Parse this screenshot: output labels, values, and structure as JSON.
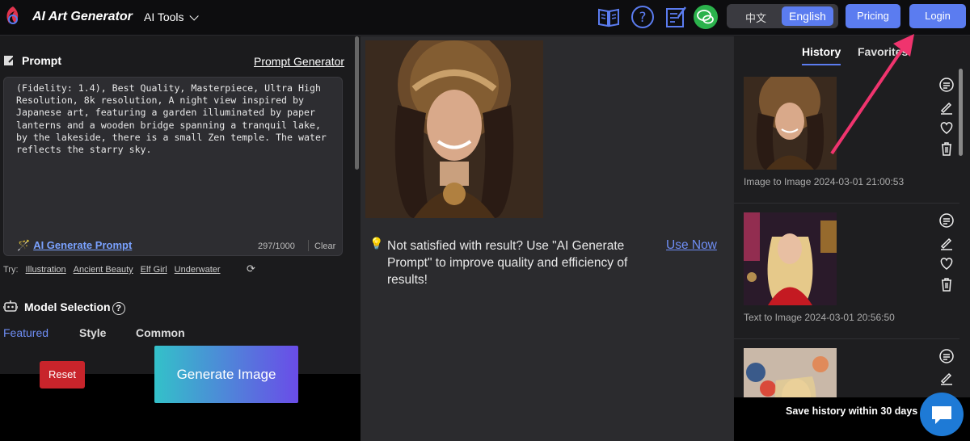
{
  "header": {
    "brand": "AI Art Generator",
    "ai_tools": "AI Tools",
    "lang_zh": "中文",
    "lang_en": "English",
    "pricing": "Pricing",
    "login": "Login"
  },
  "prompt": {
    "heading": "Prompt",
    "generator_link": "Prompt Generator",
    "text": "(Fidelity: 1.4), Best Quality, Masterpiece, Ultra High Resolution, 8k resolution, A night view inspired by Japanese art, featuring a garden illuminated by paper lanterns and a wooden bridge spanning a tranquil lake, by the lakeside, there is a small Zen temple. The water reflects the starry sky.",
    "ai_generate": "AI Generate Prompt",
    "count": "297/1000",
    "clear": "Clear",
    "try_label": "Try:",
    "try_items": [
      "Illustration",
      "Ancient Beauty",
      "Elf Girl",
      "Underwater"
    ]
  },
  "model": {
    "heading": "Model Selection",
    "tabs": [
      "Featured",
      "Style",
      "Common"
    ],
    "active_tab": "Featured"
  },
  "actions": {
    "reset": "Reset",
    "generate": "Generate Image"
  },
  "result": {
    "message": "Not satisfied with result? Use \"AI Generate Prompt\" to improve quality and efficiency of results!",
    "use_now": "Use Now"
  },
  "history": {
    "tabs": [
      "History",
      "Favorites"
    ],
    "items": [
      {
        "caption": "Image to Image 2024-03-01 21:00:53"
      },
      {
        "caption": "Text to Image 2024-03-01 20:56:50"
      },
      {
        "caption": ""
      }
    ],
    "save_note": "Save history within 30 days"
  },
  "colors": {
    "accent": "#5b7cf0",
    "reset": "#c8242b",
    "wechat": "#2bb24c",
    "arrow": "#f0346e"
  },
  "icons": [
    "logo-icon",
    "guide-book-icon",
    "help-icon",
    "feedback-icon",
    "wechat-icon",
    "edit-icon",
    "magic-wand-icon",
    "refresh-icon",
    "robot-icon",
    "bulb-icon",
    "copy-prompt-icon",
    "pencil-icon",
    "heart-icon",
    "trash-icon",
    "chat-icon"
  ]
}
